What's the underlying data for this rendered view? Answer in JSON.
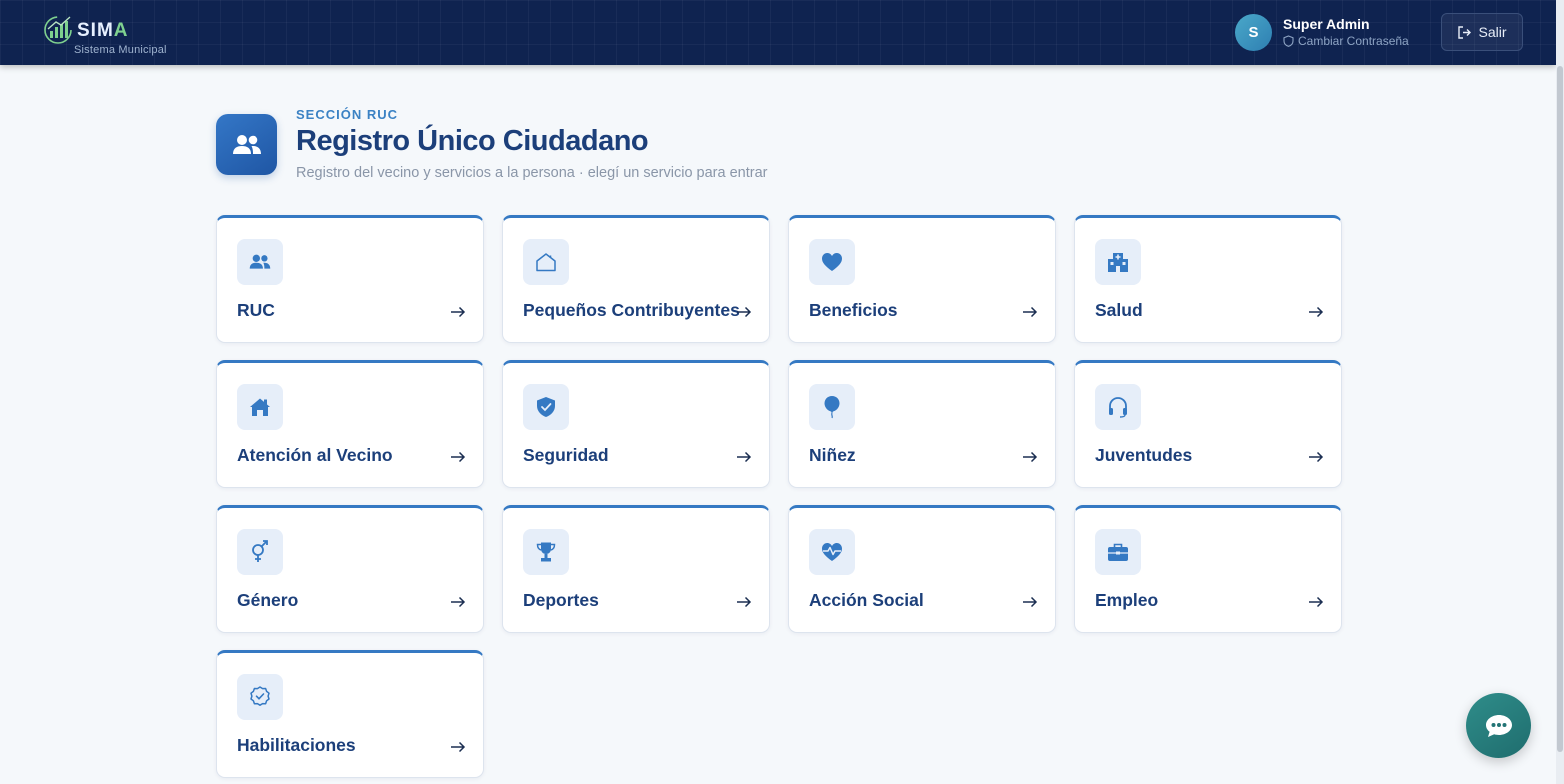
{
  "header": {
    "logo_prefix": "SIM",
    "logo_accent": "A",
    "logo_subtitle": "Sistema Municipal",
    "user_initial": "S",
    "user_name": "Super Admin",
    "change_password": "Cambiar Contraseña",
    "logout_label": "Salir"
  },
  "section": {
    "eyebrow": "SECCIÓN RUC",
    "title": "Registro Único Ciudadano",
    "subtitle": "Registro del vecino y servicios a la persona · elegí un servicio para entrar",
    "icon": "users-icon"
  },
  "cards": [
    {
      "label": "RUC",
      "icon": "users-icon"
    },
    {
      "label": "Pequeños Contribuyentes",
      "icon": "house-icon"
    },
    {
      "label": "Beneficios",
      "icon": "heart-icon"
    },
    {
      "label": "Salud",
      "icon": "hospital-icon"
    },
    {
      "label": "Atención al Vecino",
      "icon": "home-icon"
    },
    {
      "label": "Seguridad",
      "icon": "shield-icon"
    },
    {
      "label": "Niñez",
      "icon": "balloon-icon"
    },
    {
      "label": "Juventudes",
      "icon": "headphones-icon"
    },
    {
      "label": "Género",
      "icon": "gender-icon"
    },
    {
      "label": "Deportes",
      "icon": "trophy-icon"
    },
    {
      "label": "Acción Social",
      "icon": "heart-pulse-icon"
    },
    {
      "label": "Empleo",
      "icon": "briefcase-icon"
    },
    {
      "label": "Habilitaciones",
      "icon": "badge-check-icon"
    }
  ],
  "colors": {
    "header_bg": "#0f2350",
    "accent": "#3579c3",
    "title": "#1c3f7a",
    "chat_fab": "#2a7f7e"
  },
  "chat": {
    "icon": "chat-bubble-icon"
  }
}
